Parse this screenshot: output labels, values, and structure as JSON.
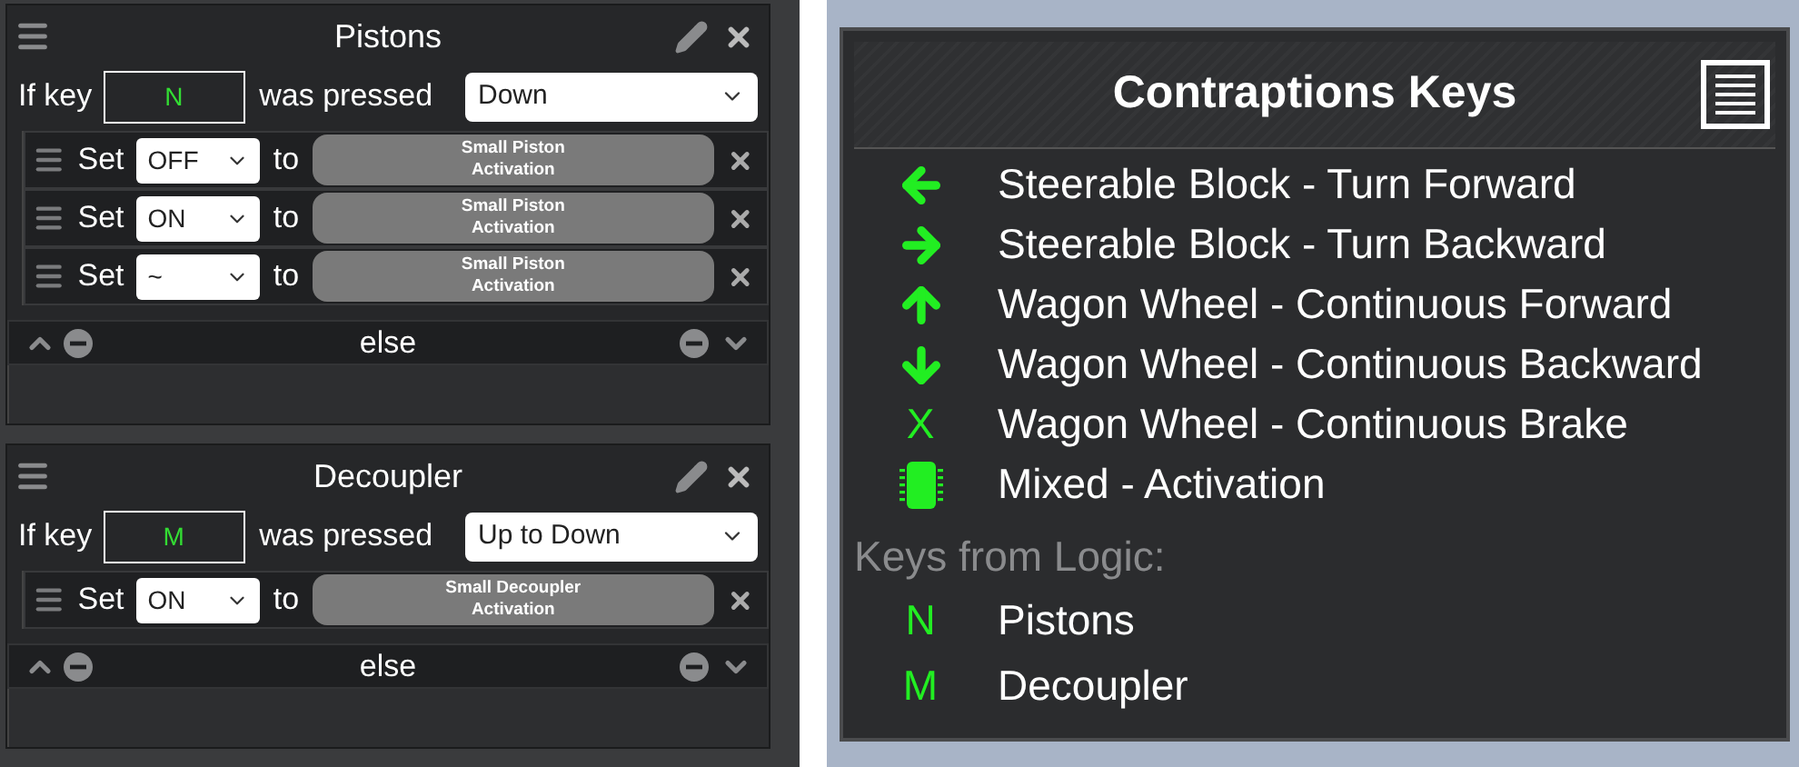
{
  "rules": [
    {
      "title": "Pistons",
      "if_label": "If key",
      "key": "N",
      "pressed_label": "was pressed",
      "mode": "Down",
      "else_label": "else",
      "actions": [
        {
          "set_label": "Set",
          "value": "OFF",
          "to_label": "to",
          "target": "Small Piston Activation"
        },
        {
          "set_label": "Set",
          "value": "ON",
          "to_label": "to",
          "target": "Small Piston Activation"
        },
        {
          "set_label": "Set",
          "value": "~",
          "to_label": "to",
          "target": "Small Piston Activation"
        }
      ]
    },
    {
      "title": "Decoupler",
      "if_label": "If key",
      "key": "M",
      "pressed_label": "was pressed",
      "mode": "Up to Down",
      "else_label": "else",
      "actions": [
        {
          "set_label": "Set",
          "value": "ON",
          "to_label": "to",
          "target": "Small Decoupler Activation"
        }
      ]
    }
  ],
  "keys_panel": {
    "title": "Contraptions Keys",
    "entries": [
      {
        "kind": "arrow-left",
        "label": "Steerable Block - Turn Forward"
      },
      {
        "kind": "arrow-right",
        "label": "Steerable Block - Turn Backward"
      },
      {
        "kind": "arrow-up",
        "label": "Wagon Wheel - Continuous Forward"
      },
      {
        "kind": "arrow-down",
        "label": "Wagon Wheel - Continuous Backward"
      },
      {
        "kind": "letter",
        "key": "X",
        "label": "Wagon Wheel - Continuous Brake"
      },
      {
        "kind": "chip",
        "label": "Mixed - Activation"
      }
    ],
    "logic_heading": "Keys from Logic:",
    "logic_entries": [
      {
        "key": "N",
        "label": "Pistons"
      },
      {
        "key": "M",
        "label": "Decoupler"
      }
    ]
  }
}
